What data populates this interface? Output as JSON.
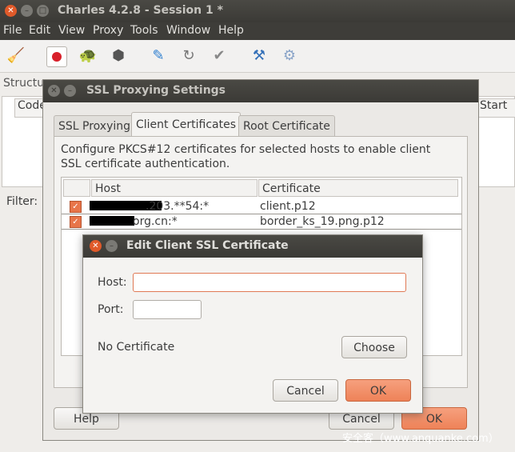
{
  "app": {
    "title": "Charles 4.2.8 - Session 1 *",
    "menu": [
      "File",
      "Edit",
      "View",
      "Proxy",
      "Tools",
      "Window",
      "Help"
    ]
  },
  "toolbar": {
    "icons": [
      "broom-icon",
      "record-icon",
      "throttle-turtle-icon",
      "breakpoint-hexagon-icon",
      "compose-pen-icon",
      "repeat-icon",
      "validate-check-icon",
      "tools-icon",
      "settings-gear-icon"
    ]
  },
  "background": {
    "structure_tab": "Structu",
    "code_col": "Code",
    "start_col": "Start",
    "filter_label": "Filter:"
  },
  "ssl_dialog": {
    "title": "SSL Proxying Settings",
    "tabs": [
      "SSL Proxying",
      "Client Certificates",
      "Root Certificate"
    ],
    "active_tab": "Client Certificates",
    "description": "Configure PKCS#12 certificates for selected hosts to enable client SSL certificate authentication.",
    "table": {
      "headers": [
        "Host",
        "Certificate"
      ],
      "rows": [
        {
          "host": "**.***.***.203.**54:*",
          "host_visible": ".203.**54:*",
          "certificate": "client.p12",
          "checked": true
        },
        {
          "host": "*.org.cn:*",
          "host_visible": "org.cn:*",
          "certificate": "border_ks_19.png.p12",
          "checked": true
        }
      ]
    },
    "help_button": "Help",
    "cancel_button": "Cancel",
    "ok_button": "OK"
  },
  "edit_dialog": {
    "title": "Edit Client SSL Certificate",
    "host_label": "Host:",
    "host_value": "",
    "port_label": "Port:",
    "port_value": "",
    "cert_status": "No Certificate",
    "choose_button": "Choose",
    "cancel_button": "Cancel",
    "ok_button": "OK"
  },
  "watermark": "安全客（www.anquanke.com）",
  "colors": {
    "accent": "#ee8258",
    "titlebar": "#3e3d39",
    "close": "#e05a2a"
  }
}
